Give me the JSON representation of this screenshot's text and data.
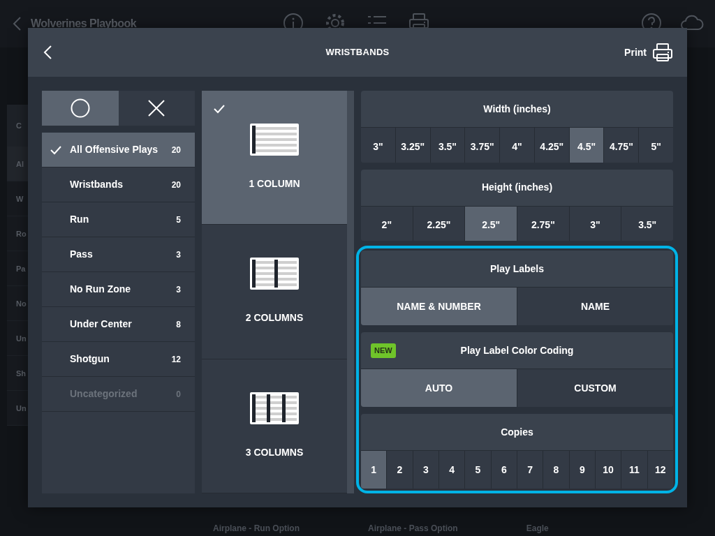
{
  "background": {
    "title": "Wolverines Playbook",
    "sidebar_header": "C",
    "sidebar_fragments": [
      {
        "label": "Al",
        "selected": true
      },
      {
        "label": "W",
        "selected": false
      },
      {
        "label": "Ro",
        "selected": false
      },
      {
        "label": "Pa",
        "selected": false
      },
      {
        "label": "No",
        "selected": false
      },
      {
        "label": "Un",
        "selected": false
      },
      {
        "label": "Sh",
        "selected": false
      },
      {
        "label": "Un",
        "selected": false
      }
    ],
    "cards": [
      "Airplane - Run Option",
      "Airplane - Pass Option",
      "Eagle"
    ]
  },
  "dialog": {
    "title": "WRISTBANDS",
    "print_label": "Print"
  },
  "mode_toggle": [
    {
      "kind": "circle",
      "selected": true
    },
    {
      "kind": "cross",
      "selected": false
    }
  ],
  "categories": [
    {
      "label": "All Offensive Plays",
      "count": "20",
      "selected": true,
      "disabled": false
    },
    {
      "label": "Wristbands",
      "count": "20",
      "selected": false,
      "disabled": false
    },
    {
      "label": "Run",
      "count": "5",
      "selected": false,
      "disabled": false
    },
    {
      "label": "Pass",
      "count": "3",
      "selected": false,
      "disabled": false
    },
    {
      "label": "No Run Zone",
      "count": "3",
      "selected": false,
      "disabled": false
    },
    {
      "label": "Under Center",
      "count": "8",
      "selected": false,
      "disabled": false
    },
    {
      "label": "Shotgun",
      "count": "12",
      "selected": false,
      "disabled": false
    },
    {
      "label": "Uncategorized",
      "count": "0",
      "selected": false,
      "disabled": true
    }
  ],
  "layouts": [
    {
      "label": "1 COLUMN",
      "kind": "one",
      "selected": true
    },
    {
      "label": "2 COLUMNS",
      "kind": "two",
      "selected": false
    },
    {
      "label": "3 COLUMNS",
      "kind": "three",
      "selected": false
    }
  ],
  "width": {
    "title": "Width (inches)",
    "options": [
      {
        "label": "3\"",
        "selected": false
      },
      {
        "label": "3.25\"",
        "selected": false
      },
      {
        "label": "3.5\"",
        "selected": false
      },
      {
        "label": "3.75\"",
        "selected": false
      },
      {
        "label": "4\"",
        "selected": false
      },
      {
        "label": "4.25\"",
        "selected": false
      },
      {
        "label": "4.5\"",
        "selected": true
      },
      {
        "label": "4.75\"",
        "selected": false
      },
      {
        "label": "5\"",
        "selected": false
      }
    ]
  },
  "height": {
    "title": "Height (inches)",
    "options": [
      {
        "label": "2\"",
        "selected": false
      },
      {
        "label": "2.25\"",
        "selected": false
      },
      {
        "label": "2.5\"",
        "selected": true
      },
      {
        "label": "2.75\"",
        "selected": false
      },
      {
        "label": "3\"",
        "selected": false
      },
      {
        "label": "3.5\"",
        "selected": false
      }
    ]
  },
  "label_settings": {
    "highlighted": true,
    "play_labels": {
      "title": "Play Labels",
      "options": [
        {
          "label": "NAME & NUMBER",
          "selected": true
        },
        {
          "label": "NAME",
          "selected": false
        }
      ]
    },
    "color_coding": {
      "badge": "NEW",
      "title": "Play Label Color Coding",
      "options": [
        {
          "label": "AUTO",
          "selected": true
        },
        {
          "label": "CUSTOM",
          "selected": false
        }
      ]
    },
    "copies": {
      "title": "Copies",
      "options": [
        {
          "label": "1",
          "selected": true
        },
        {
          "label": "2",
          "selected": false
        },
        {
          "label": "3",
          "selected": false
        },
        {
          "label": "4",
          "selected": false
        },
        {
          "label": "5",
          "selected": false
        },
        {
          "label": "6",
          "selected": false
        },
        {
          "label": "7",
          "selected": false
        },
        {
          "label": "8",
          "selected": false
        },
        {
          "label": "9",
          "selected": false
        },
        {
          "label": "10",
          "selected": false
        },
        {
          "label": "11",
          "selected": false
        },
        {
          "label": "12",
          "selected": false
        }
      ]
    }
  }
}
